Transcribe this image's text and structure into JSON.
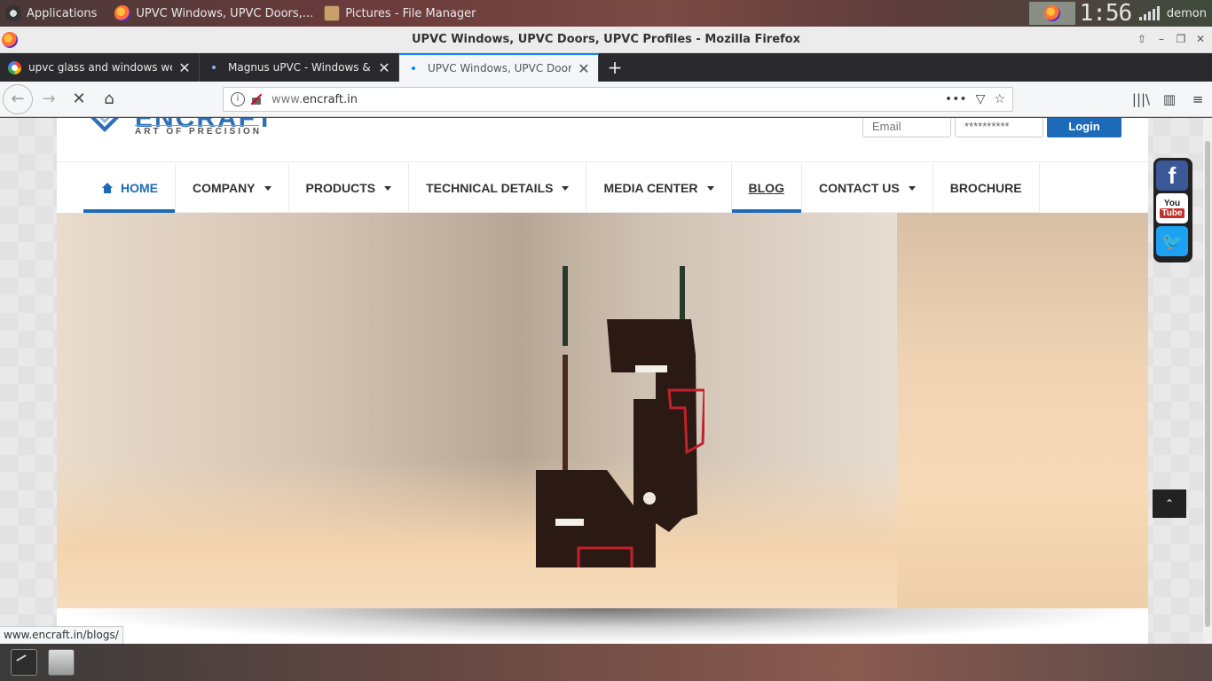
{
  "desktop": {
    "apps_label": "Applications",
    "taskbar_items": [
      "UPVC Windows, UPVC Doors,...",
      "Pictures - File Manager"
    ],
    "clock": "1:56",
    "user": "demon"
  },
  "browser": {
    "window_title": "UPVC Windows, UPVC Doors, UPVC Profiles - Mozilla Firefox",
    "tabs": [
      {
        "label": "upvc glass and windows webs",
        "active": false
      },
      {
        "label": "Magnus uPVC - Windows & Do",
        "active": false
      },
      {
        "label": "UPVC Windows, UPVC Doors,",
        "active": true
      }
    ],
    "url_prefix": "www.",
    "url_domain": "encraft.in",
    "status_url": "www.encraft.in/blogs/"
  },
  "site": {
    "logo_name": "ENCRAFT",
    "logo_tagline": "ART OF PRECISION",
    "login": {
      "email_placeholder": "Email",
      "password_value": "**********",
      "button": "Login"
    },
    "menu": [
      {
        "label": "HOME",
        "has_caret": false
      },
      {
        "label": "COMPANY",
        "has_caret": true
      },
      {
        "label": "PRODUCTS",
        "has_caret": true
      },
      {
        "label": "TECHNICAL DETAILS",
        "has_caret": true
      },
      {
        "label": "MEDIA CENTER",
        "has_caret": true
      },
      {
        "label": "BLOG",
        "has_caret": false
      },
      {
        "label": "CONTACT US",
        "has_caret": true
      },
      {
        "label": "BROCHURE",
        "has_caret": false
      }
    ],
    "social": {
      "facebook": "f",
      "youtube_top": "You",
      "youtube_bottom": "Tube"
    }
  },
  "colors": {
    "accent": "#1d6bb8",
    "firefox_tab_bar": "#2a2a2e"
  },
  "icons": [
    "applications-icon",
    "firefox-icon",
    "folder-icon",
    "back-icon",
    "forward-icon",
    "stop-icon",
    "home-icon",
    "info-icon",
    "insecure-lock-icon",
    "more-icon",
    "pocket-icon",
    "bookmark-star-icon",
    "library-icon",
    "sidebar-icon",
    "menu-icon",
    "facebook-icon",
    "youtube-icon",
    "twitter-icon",
    "chevron-up-icon",
    "terminal-icon",
    "file-manager-icon"
  ]
}
